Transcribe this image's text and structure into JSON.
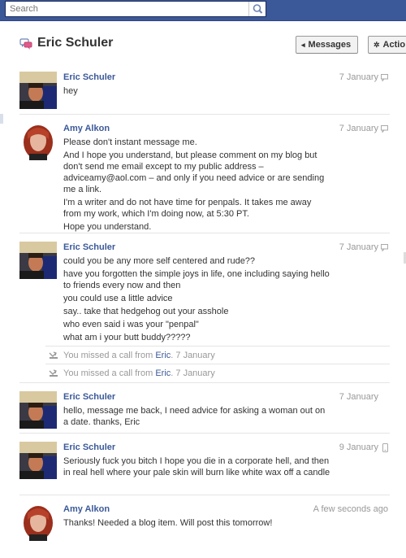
{
  "search": {
    "placeholder": "Search"
  },
  "header": {
    "title": "Eric Schuler",
    "messages_button": "Messages",
    "actions_button": "Actio"
  },
  "messages": [
    {
      "sender": "Eric Schuler",
      "time": "7 January",
      "lines": [
        "hey"
      ]
    },
    {
      "sender": "Amy Alkon",
      "time": "7 January",
      "lines": [
        "Please don't instant message me.",
        "And I hope you understand, but please comment on my blog but don't send me email except to my public address – adviceamy@aol.com – and only if you need advice or are sending me a link.",
        "I'm a writer and do not have time for penpals. It takes me away from my work, which I'm doing now, at 5:30 PT.",
        "Hope you understand."
      ]
    },
    {
      "sender": "Eric Schuler",
      "time": "7 January",
      "lines": [
        "could you be any more self centered and rude??",
        "have you forgotten the simple joys in life, one including saying hello to friends every now and then",
        "you could use a little advice",
        "say.. take that hedgehog out your asshole",
        "who even said i was your \"penpal\"",
        "what am i your butt buddy?????"
      ]
    },
    {
      "sender": "Eric Schuler",
      "time": "7 January",
      "lines": [
        "hello, message me back, I need advice for asking a woman out on a date. thanks, Eric"
      ]
    },
    {
      "sender": "Eric Schuler",
      "time": "9 January",
      "lines": [
        "Seriously fuck you bitch I hope you die in a corporate hell, and then in real hell where your pale skin will burn like white wax off a candle"
      ]
    },
    {
      "sender": "Amy Alkon",
      "time": "A few seconds ago",
      "lines": [
        "Thanks! Needed a blog item. Will post this tomorrow!"
      ]
    }
  ],
  "missed_calls": [
    {
      "prefix": "You missed a call from ",
      "caller": "Eric",
      "suffix": ".",
      "time": "7 January"
    },
    {
      "prefix": "You missed a call from ",
      "caller": "Eric",
      "suffix": ".",
      "time": "7 January"
    }
  ],
  "colors": {
    "topbar": "#3b5998",
    "link": "#3b5998",
    "muted": "#999999"
  }
}
